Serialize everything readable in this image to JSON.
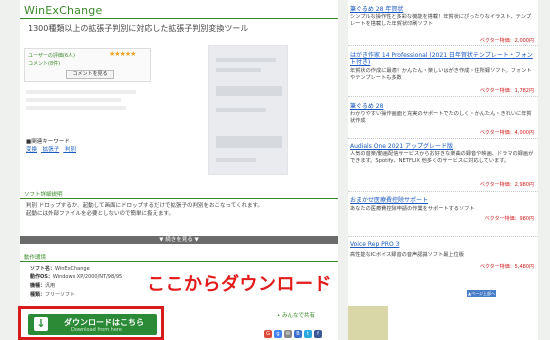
{
  "app": {
    "title": "WinExChange",
    "subtitle": "1300種類以上の拡張子判別に対応した拡張子判別変換ツール"
  },
  "rating": {
    "label": "ユーザーの評価(6人)",
    "stars": "★★★★★",
    "comments": "コメント(8件)",
    "comment_button": "コメントを見る"
  },
  "related": {
    "heading": "■関連キーワード",
    "links": [
      "変換",
      "拡張子",
      "判別"
    ]
  },
  "description": {
    "heading": "ソフト詳細説明",
    "lines": [
      "判別 ドロップするか、起動して画面にドロップするだけで拡張子の判別をおこなってくれます。",
      "起動には外部ファイルを必要としないので簡単に扱えます。"
    ],
    "more_button": "▼ 続きを見る ▼"
  },
  "environment": {
    "heading": "動作環境",
    "rows": [
      {
        "label": "ソフト名：",
        "value": "WinExChange"
      },
      {
        "label": "動作OS：",
        "value": "Windows XP/2000/NT/98/95"
      },
      {
        "label": "機種：",
        "value": "汎用"
      },
      {
        "label": "種類：",
        "value": "フリーソフト"
      }
    ]
  },
  "annotation": {
    "text": "ここからダウンロード"
  },
  "download": {
    "label": "ダウンロードはこちら",
    "sub": "Download from here"
  },
  "share": {
    "label": "• みんなで共有",
    "icons": [
      "G",
      "g",
      "✉",
      "B",
      "t",
      "f"
    ],
    "colors": [
      "#dd4b39",
      "#4285f4",
      "#888888",
      "#3a6fd0",
      "#29a9e0",
      "#3b5998"
    ]
  },
  "sidebar": {
    "items": [
      {
        "link": "筆ぐるめ 28 年賀状",
        "text": "シンプルな操作性と多彩な機能を搭載！年賀状にぴったりなイラスト、テンプレートを搭載した年賀状印刷ソフト",
        "price": "ベクター特価：2,000円"
      },
      {
        "link": "はがき作家 14 Professional (2021 日年賀状テンプレート・フォント付き)",
        "text": "年賀状の作成に最適！かんたん・楽しいはがき作成・住所録ソフト。フォントやテンプレートも多数",
        "price": "ベクター特価：1,782円"
      },
      {
        "link": "筆ぐるめ 28",
        "text": "わかりやすい操作画面と充実のサポートでたのしく・かんたん・きれいに年賀状作成",
        "price": "ベクター特価：4,000円"
      },
      {
        "link": "Audials One 2021 アップグレード版",
        "text": "人気の音楽/動画配信サービスからお好きな楽曲の録音や映画、ドラマの録画ができます。Spotify、NETFLIX 他多くのサービスに対応しています。",
        "price": "ベクター特価：2,980円"
      },
      {
        "link": "おまかせ医療費控除サポート",
        "text": "あなたの医療費控除申請の作業をサポートするソフト",
        "price": "ベクター特価：980円"
      },
      {
        "link": "Voice Rep PRO 3",
        "text": "高性能なICボイス録音の音声認識ソフト最上位版",
        "price": "ベクター特価：5,480円"
      }
    ],
    "top_button": "▲ページ上部へ"
  }
}
